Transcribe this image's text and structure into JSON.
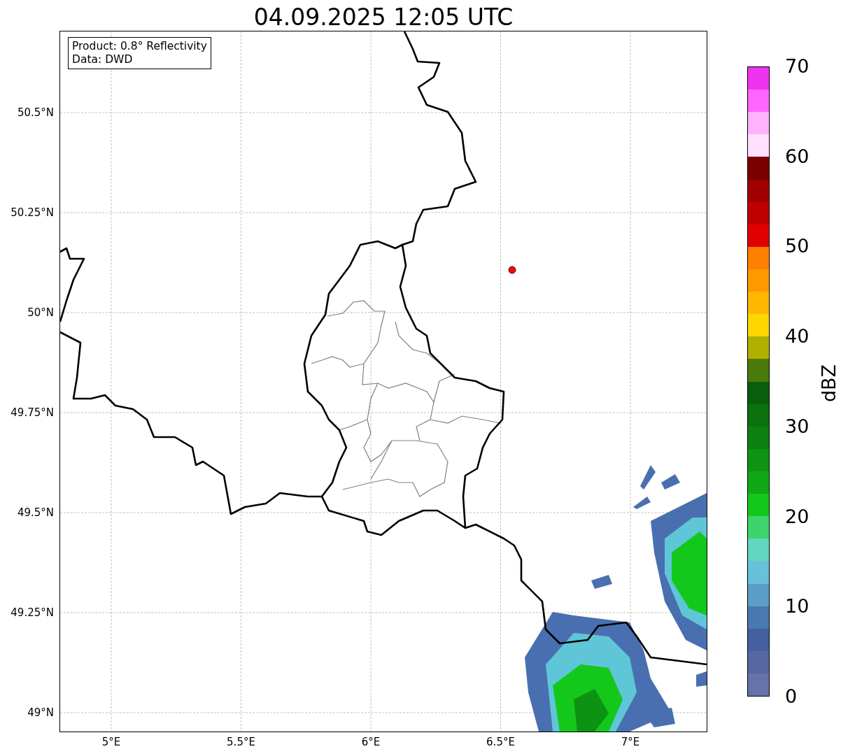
{
  "title": "04.09.2025 12:05 UTC",
  "map": {
    "legend": [
      "Product: 0.8° Reflectivity",
      "Data: DWD"
    ],
    "y_ticks": [
      "50.5°N",
      "50.25°N",
      "50°N",
      "49.75°N",
      "49.5°N",
      "49.25°N",
      "49°N"
    ],
    "x_ticks": [
      "5°E",
      "5.5°E",
      "6°E",
      "6.5°E",
      "7°E"
    ]
  },
  "colorbar": {
    "label": "dBZ",
    "ticks": [
      "70",
      "60",
      "50",
      "40",
      "30",
      "20",
      "10",
      "0"
    ],
    "bins": [
      {
        "color": "#ee33ee"
      },
      {
        "color": "#ff66ff"
      },
      {
        "color": "#ffb3ff"
      },
      {
        "color": "#ffe0ff"
      },
      {
        "color": "#7a0000"
      },
      {
        "color": "#a00000"
      },
      {
        "color": "#c00000"
      },
      {
        "color": "#e00000"
      },
      {
        "color": "#ff7f00"
      },
      {
        "color": "#ff9900"
      },
      {
        "color": "#ffb700"
      },
      {
        "color": "#ffd700"
      },
      {
        "color": "#b0b000"
      },
      {
        "color": "#4a7a0a"
      },
      {
        "color": "#085e0a"
      },
      {
        "color": "#0b720d"
      },
      {
        "color": "#0c8010"
      },
      {
        "color": "#0e9412"
      },
      {
        "color": "#10a814"
      },
      {
        "color": "#12c81a"
      },
      {
        "color": "#3dd46c"
      },
      {
        "color": "#61d6c0"
      },
      {
        "color": "#67c1db"
      },
      {
        "color": "#5a9ec6"
      },
      {
        "color": "#4a79b0"
      },
      {
        "color": "#4560a0"
      },
      {
        "color": "#5568a0"
      },
      {
        "color": "#6672a8"
      }
    ]
  }
}
